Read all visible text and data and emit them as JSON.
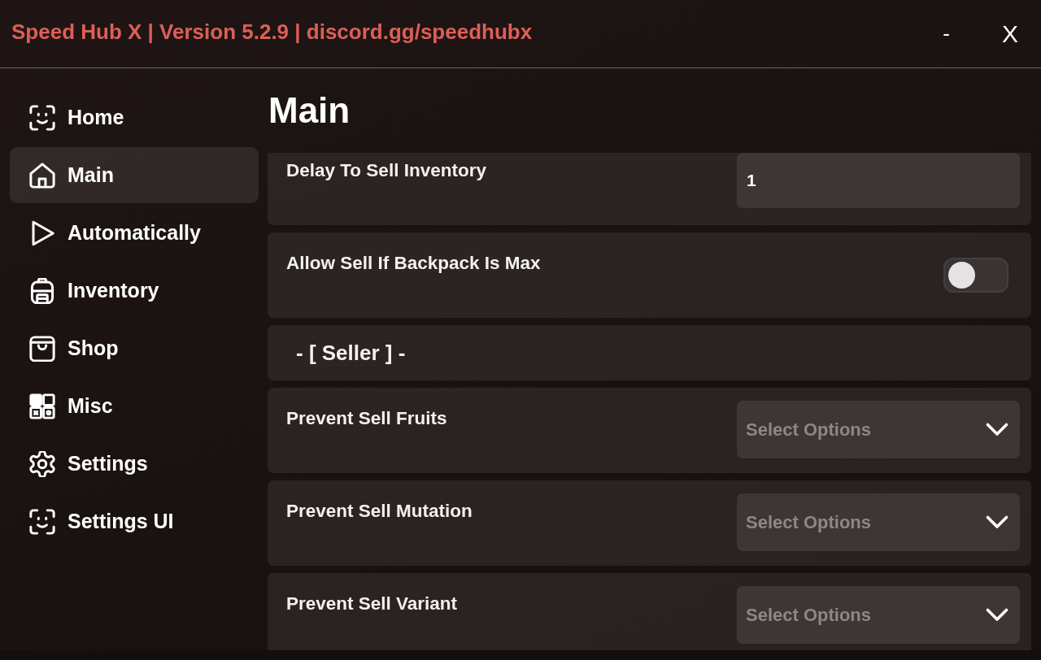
{
  "window": {
    "title": "Speed Hub X | Version 5.2.9 | discord.gg/speedhubx",
    "controls": [
      "-",
      "X"
    ]
  },
  "sidebar": {
    "items": [
      {
        "label": "Home",
        "selected": false
      },
      {
        "label": "Main",
        "selected": true
      },
      {
        "label": "Automatically",
        "selected": false
      },
      {
        "label": "Inventory",
        "selected": false
      },
      {
        "label": "Shop",
        "selected": false
      },
      {
        "label": "Misc",
        "selected": false
      },
      {
        "label": "Settings",
        "selected": false
      },
      {
        "label": "Settings UI",
        "selected": false
      }
    ]
  },
  "page": {
    "title": "Main",
    "settings": [
      {
        "kind": "input",
        "label": "Delay To Sell Inventory",
        "value": "1"
      },
      {
        "kind": "toggle",
        "label": "Allow Sell If Backpack Is Max",
        "on": false
      },
      {
        "kind": "section",
        "label": "- [ Seller ] -"
      },
      {
        "kind": "dropdown",
        "label": "Prevent Sell Fruits",
        "placeholder": "Select Options"
      },
      {
        "kind": "dropdown",
        "label": "Prevent Sell Mutation",
        "placeholder": "Select Options"
      },
      {
        "kind": "dropdown",
        "label": "Prevent Sell Variant",
        "placeholder": "Select Options"
      }
    ]
  }
}
